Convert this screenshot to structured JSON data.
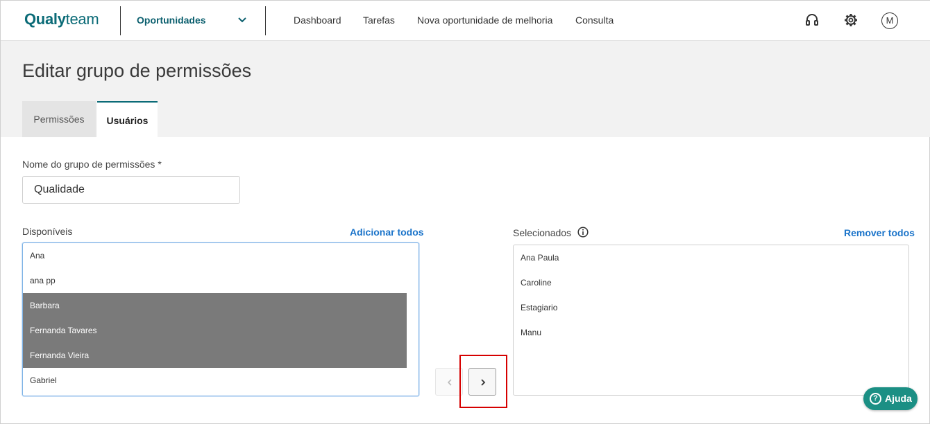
{
  "topbar": {
    "logo_bold": "Qualy",
    "logo_light": "team",
    "module": "Oportunidades",
    "nav": [
      "Dashboard",
      "Tarefas",
      "Nova oportunidade de melhoria",
      "Consulta"
    ],
    "avatar_initial": "M",
    "icons": [
      "headset-icon",
      "gear-icon",
      "chevron-down-icon"
    ]
  },
  "page": {
    "title": "Editar grupo de permissões",
    "tabs": [
      {
        "label": "Permissões",
        "active": false
      },
      {
        "label": "Usuários",
        "active": true
      }
    ]
  },
  "form": {
    "name_label": "Nome do grupo de permissões *",
    "name_value": "Qualidade"
  },
  "available": {
    "title": "Disponíveis",
    "action": "Adicionar todos",
    "items": [
      {
        "label": "Ana",
        "selected": false
      },
      {
        "label": "ana pp",
        "selected": false
      },
      {
        "label": "Barbara",
        "selected": true
      },
      {
        "label": "Fernanda Tavares",
        "selected": true
      },
      {
        "label": "Fernanda Vieira",
        "selected": true
      },
      {
        "label": "Gabriel",
        "selected": false
      }
    ]
  },
  "selected": {
    "title": "Selecionados",
    "action": "Remover todos",
    "items": [
      "Ana Paula",
      "Caroline",
      "Estagiario",
      "Manu"
    ]
  },
  "help": {
    "label": "Ajuda"
  },
  "colors": {
    "brand": "#0b6b77",
    "link": "#1a73c9",
    "selected_row": "#7a7a7a",
    "help": "#1b8f84",
    "highlight": "#d60000"
  }
}
